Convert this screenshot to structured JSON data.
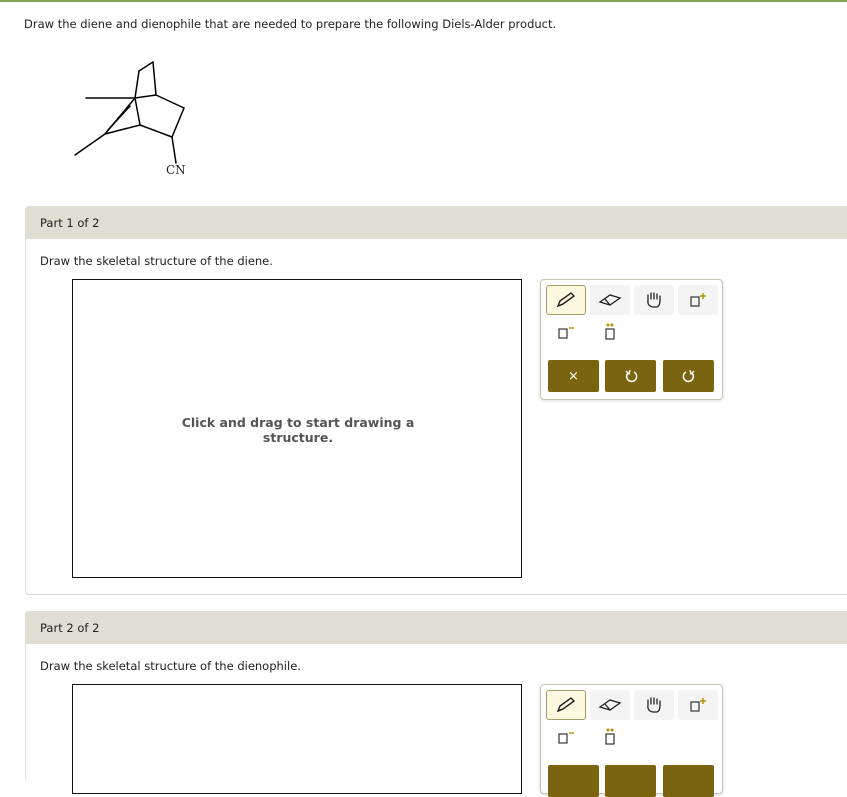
{
  "question": "Draw the diene and dienophile that are needed to prepare the following Diels-Alder product.",
  "molecule": {
    "substituent_label": "CN"
  },
  "parts": [
    {
      "header": "Part 1 of 2",
      "instruction": "Draw the skeletal structure of the diene.",
      "canvas_hint": "Click and drag to start drawing a structure."
    },
    {
      "header": "Part 2 of 2",
      "instruction": "Draw the skeletal structure of the dienophile."
    }
  ],
  "toolbar": {
    "clear_label": "×"
  },
  "colors": {
    "accent": "#7a6410",
    "header_bg": "#e0ddd3",
    "top_rule": "#7aa75a"
  }
}
